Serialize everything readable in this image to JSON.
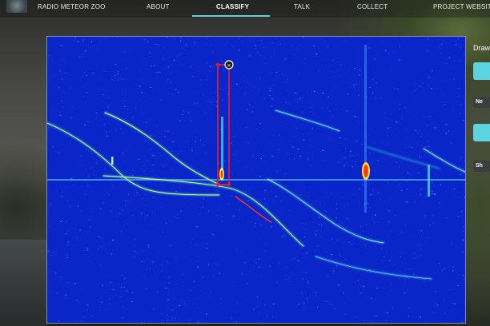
{
  "nav": {
    "site_title": "RADIO METEOR ZOO",
    "items": [
      {
        "label": "ABOUT"
      },
      {
        "label": "CLASSIFY",
        "active": true
      },
      {
        "label": "TALK"
      },
      {
        "label": "COLLECT"
      },
      {
        "label": "PROJECT WEBSITE"
      }
    ]
  },
  "side_panel": {
    "title": "Draw",
    "button_new": "Ne",
    "button_show": "Sh"
  },
  "colors": {
    "accent": "#5cd3e0",
    "spectrogram_background": "#0a25c8",
    "selection": "#e8192c"
  },
  "icons": {
    "selection_handle": "circle-handle-icon"
  }
}
